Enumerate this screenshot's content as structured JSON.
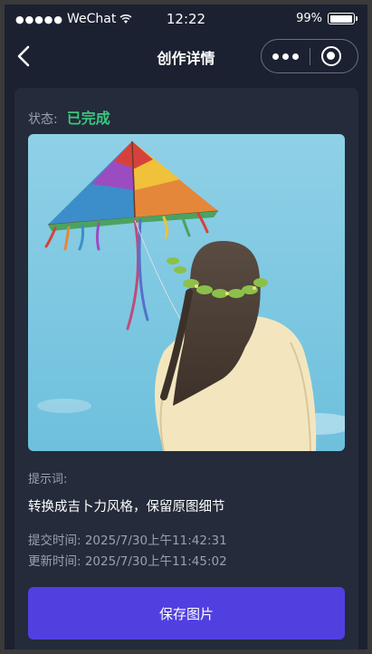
{
  "statusbar": {
    "signal": "●●●●●",
    "carrier": "WeChat",
    "time": "12:22",
    "battery_text": "99%",
    "battery_level": 0.99
  },
  "navbar": {
    "title": "创作详情"
  },
  "detail": {
    "status_label": "状态:",
    "status_value": "已完成",
    "status_color": "#3bc77e",
    "prompt_label": "提示词:",
    "prompt_text": "转换成吉卜力风格，保留原图细节",
    "submit_time": "提交时间: 2025/7/30上午11:42:31",
    "update_time": "更新时间: 2025/7/30上午11:45:02"
  },
  "actions": {
    "save_label": "保存图片",
    "accent": "#5140e0"
  }
}
